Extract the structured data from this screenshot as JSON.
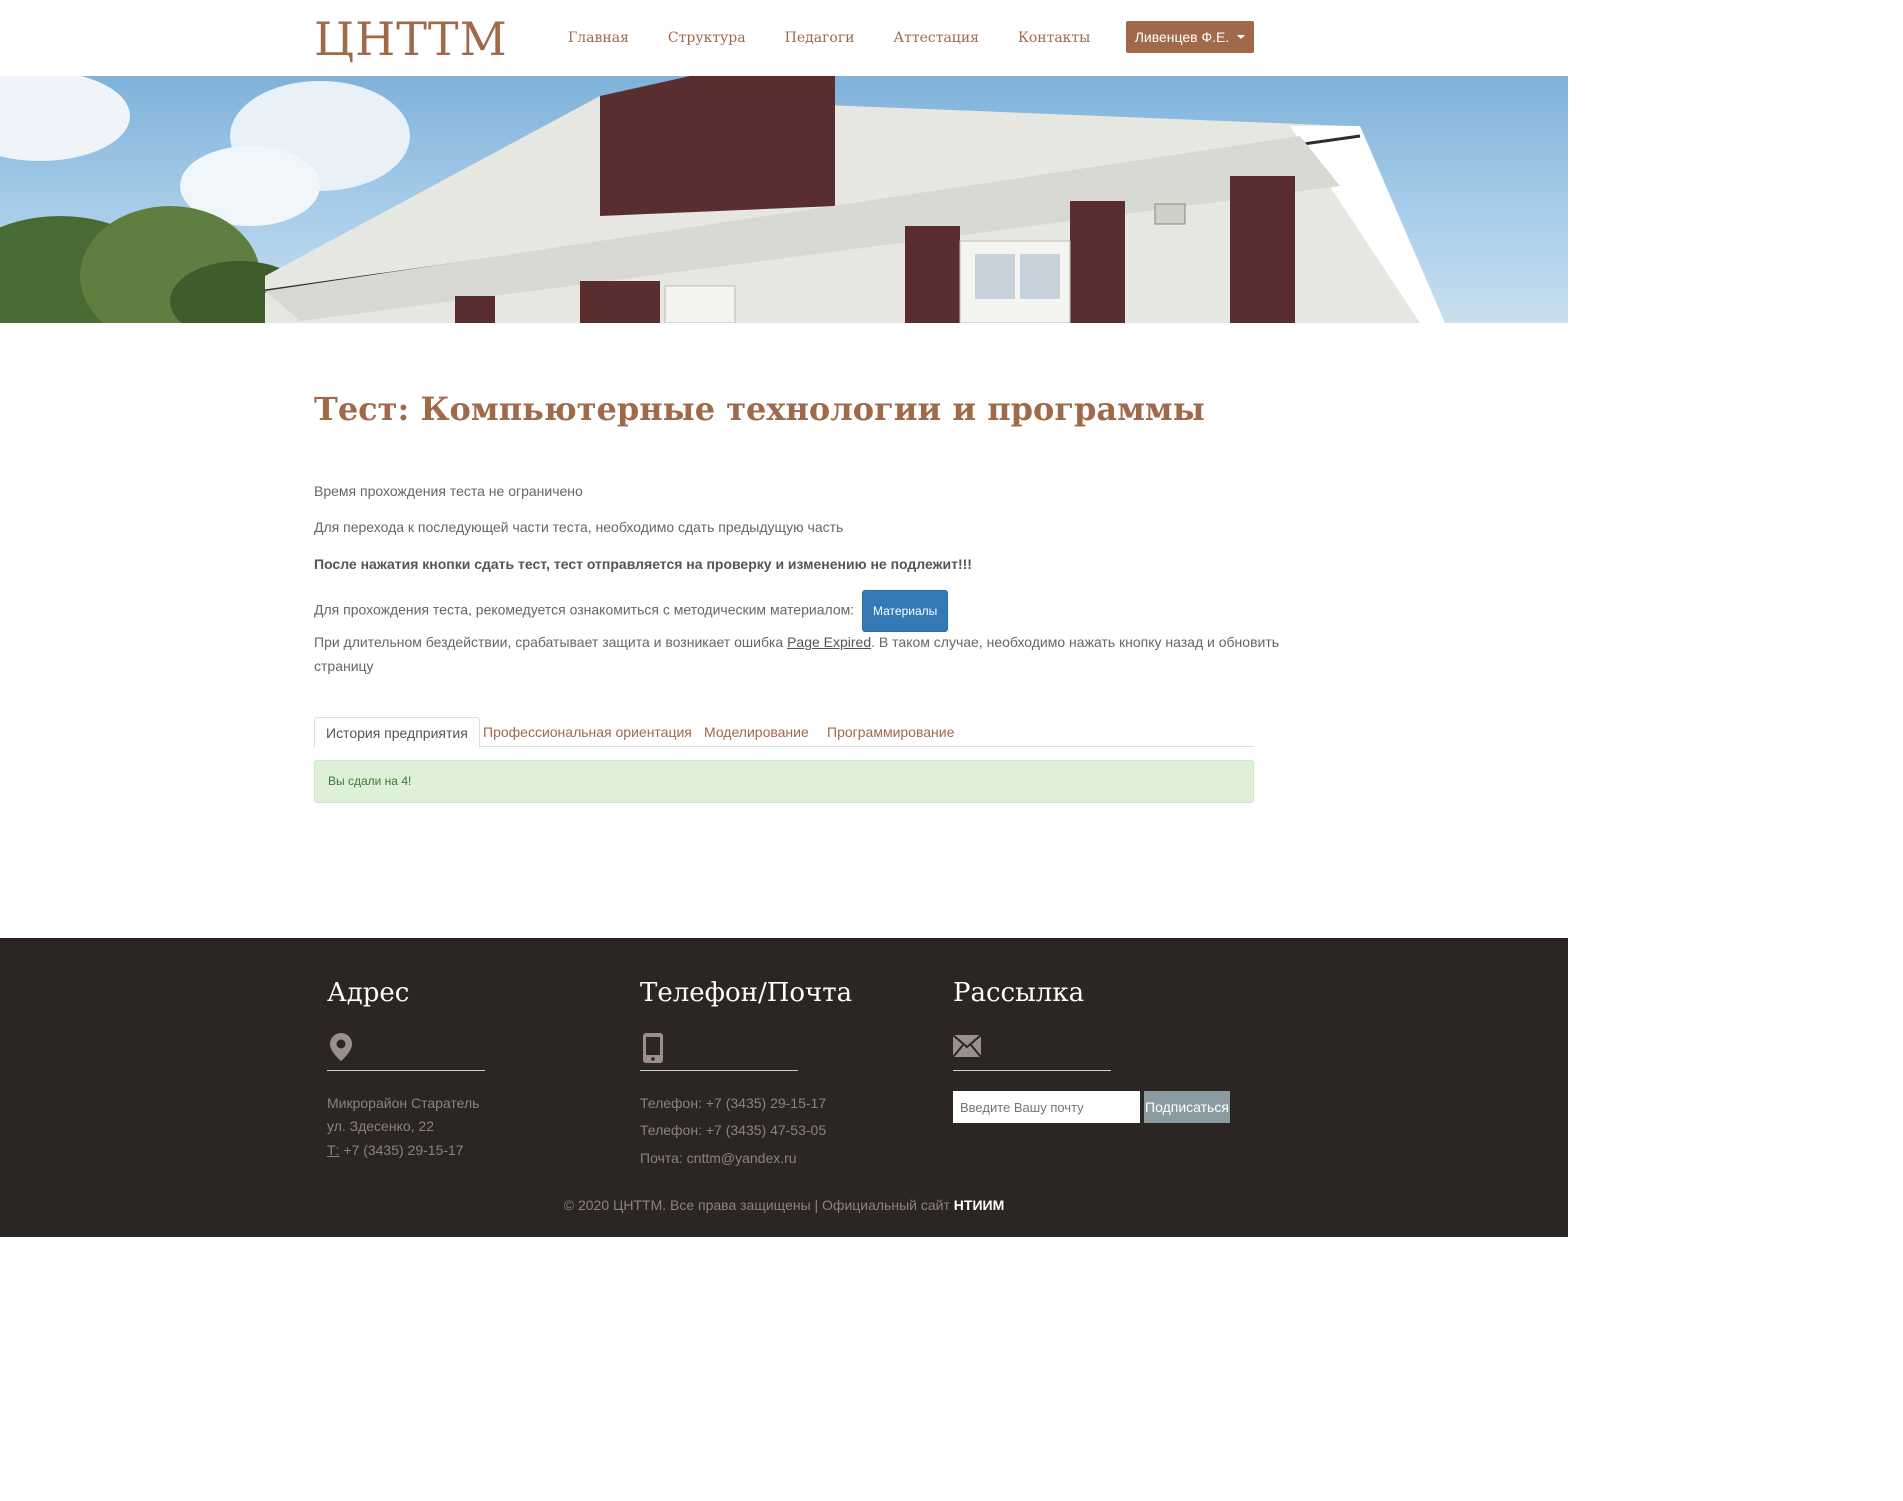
{
  "header": {
    "logo": "ЦНТТМ",
    "nav": [
      "Главная",
      "Структура",
      "Педагоги",
      "Аттестация",
      "Контакты"
    ],
    "user": "Ливенцев Ф.Е."
  },
  "main": {
    "title": "Тест: Компьютерные технологии и программы",
    "p1": "Время прохождения теста не ограничено",
    "p2": "Для перехода к последующей части теста, необходимо сдать предыдущую часть",
    "p3": "После нажатия кнопки сдать тест, тест отправляется на проверку и изменению не подлежит!!!",
    "p4": "Для прохождения теста, рекомедуется ознакомиться с методическим материалом:",
    "materials_button": "Материалы",
    "p5_before": "При длительном бездействии, срабатывает защита и возникает ошибка ",
    "p5_link": "Page Expired",
    "p5_after": ". В таком случае, необходимо нажать кнопку назад и обновить",
    "p5_line2": "страницу",
    "tabs": [
      "История предприятия",
      "Профессиональная ориентация",
      "Моделирование",
      "Программирование"
    ],
    "alert": "Вы сдали на 4!"
  },
  "footer": {
    "address_title": "Адрес",
    "address_line1": "Микрорайон Старатель",
    "address_line2": "ул. Здесенко, 22",
    "address_phone_label": "Т:",
    "address_phone": " +7 (3435) 29-15-17",
    "contacts_title": "Телефон/Почта",
    "phone1": "Телефон: +7 (3435) 29-15-17",
    "phone2": "Телефон: +7 (3435) 47-53-05",
    "email": "Почта: cnttm@yandex.ru",
    "newsletter_title": "Рассылка",
    "email_placeholder": "Введите Вашу почту",
    "subscribe_button": "Подписаться",
    "copyright_text": "© 2020 ЦНТТМ. Все права защищены | Официальный сайт ",
    "copyright_link": "НТИИМ"
  },
  "icons": {
    "address": "map-marker-icon",
    "phone": "mobile-phone-icon",
    "mail": "envelope-icon"
  },
  "colors": {
    "brand": "#a0694a",
    "footer_bg": "#2b2523",
    "button_primary": "#337ab7",
    "alert_bg": "#dff0d8"
  }
}
